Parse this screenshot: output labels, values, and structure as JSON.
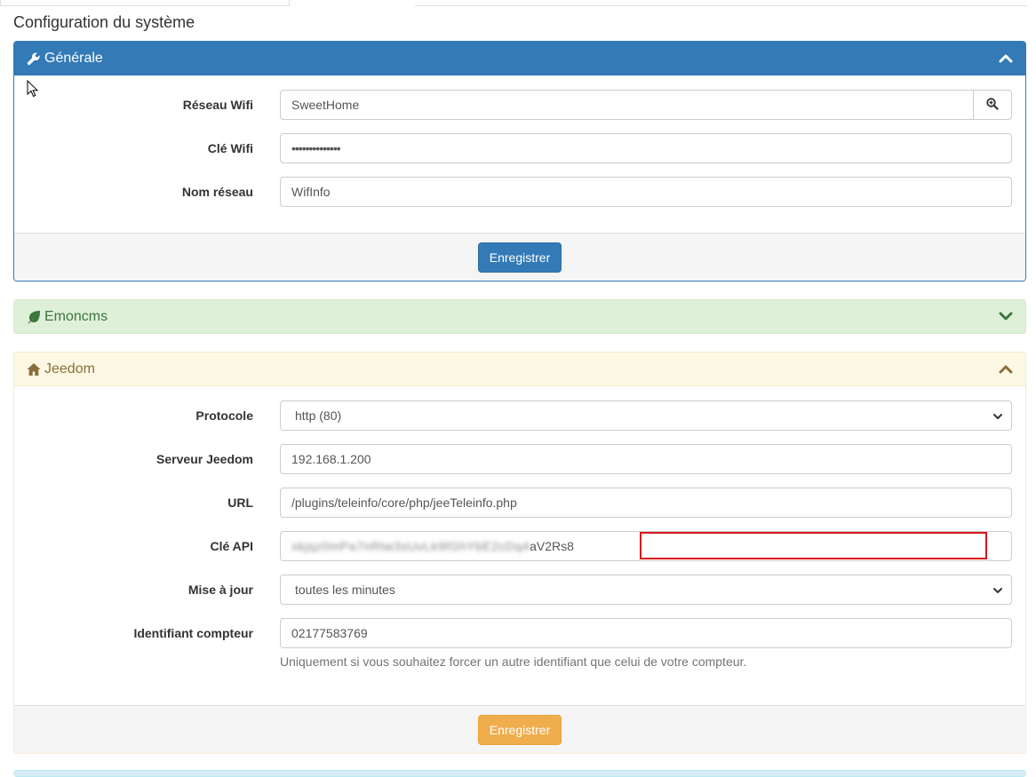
{
  "page": {
    "title": "Configuration du système"
  },
  "generale": {
    "title": "Générale",
    "fields": [
      {
        "label": "Réseau Wifi",
        "value": "SweetHome"
      },
      {
        "label": "Clé Wifi",
        "value": "••••••••••••••"
      },
      {
        "label": "Nom réseau",
        "value": "WifInfo"
      }
    ],
    "save_label": "Enregistrer"
  },
  "emoncms": {
    "title": "Emoncms"
  },
  "jeedom": {
    "title": "Jeedom",
    "fields": [
      {
        "label": "Protocole",
        "value": "http (80)"
      },
      {
        "label": "Serveur Jeedom",
        "value": "192.168.1.200"
      },
      {
        "label": "URL",
        "value": "/plugins/teleinfo/core/php/jeeTeleinfo.php"
      },
      {
        "label": "Clé API",
        "value_hidden": "xkjqz0mPa7nRtw3sUvLk9fGhYbE2cDq4",
        "value_visible": "aV2Rs8"
      },
      {
        "label": "Mise à jour",
        "value": "toutes les minutes"
      },
      {
        "label": "Identifiant compteur",
        "value": "02177583769"
      }
    ],
    "help": "Uniquement si vous souhaitez forcer un autre identifiant que celui de votre compteur.",
    "save_label": "Enregistrer"
  },
  "colors": {
    "primary": "#337ab7",
    "success": "#dff0d8",
    "warning": "#fcf8e3",
    "btn_warning": "#f0ad4e",
    "highlight": "#d9141b"
  }
}
